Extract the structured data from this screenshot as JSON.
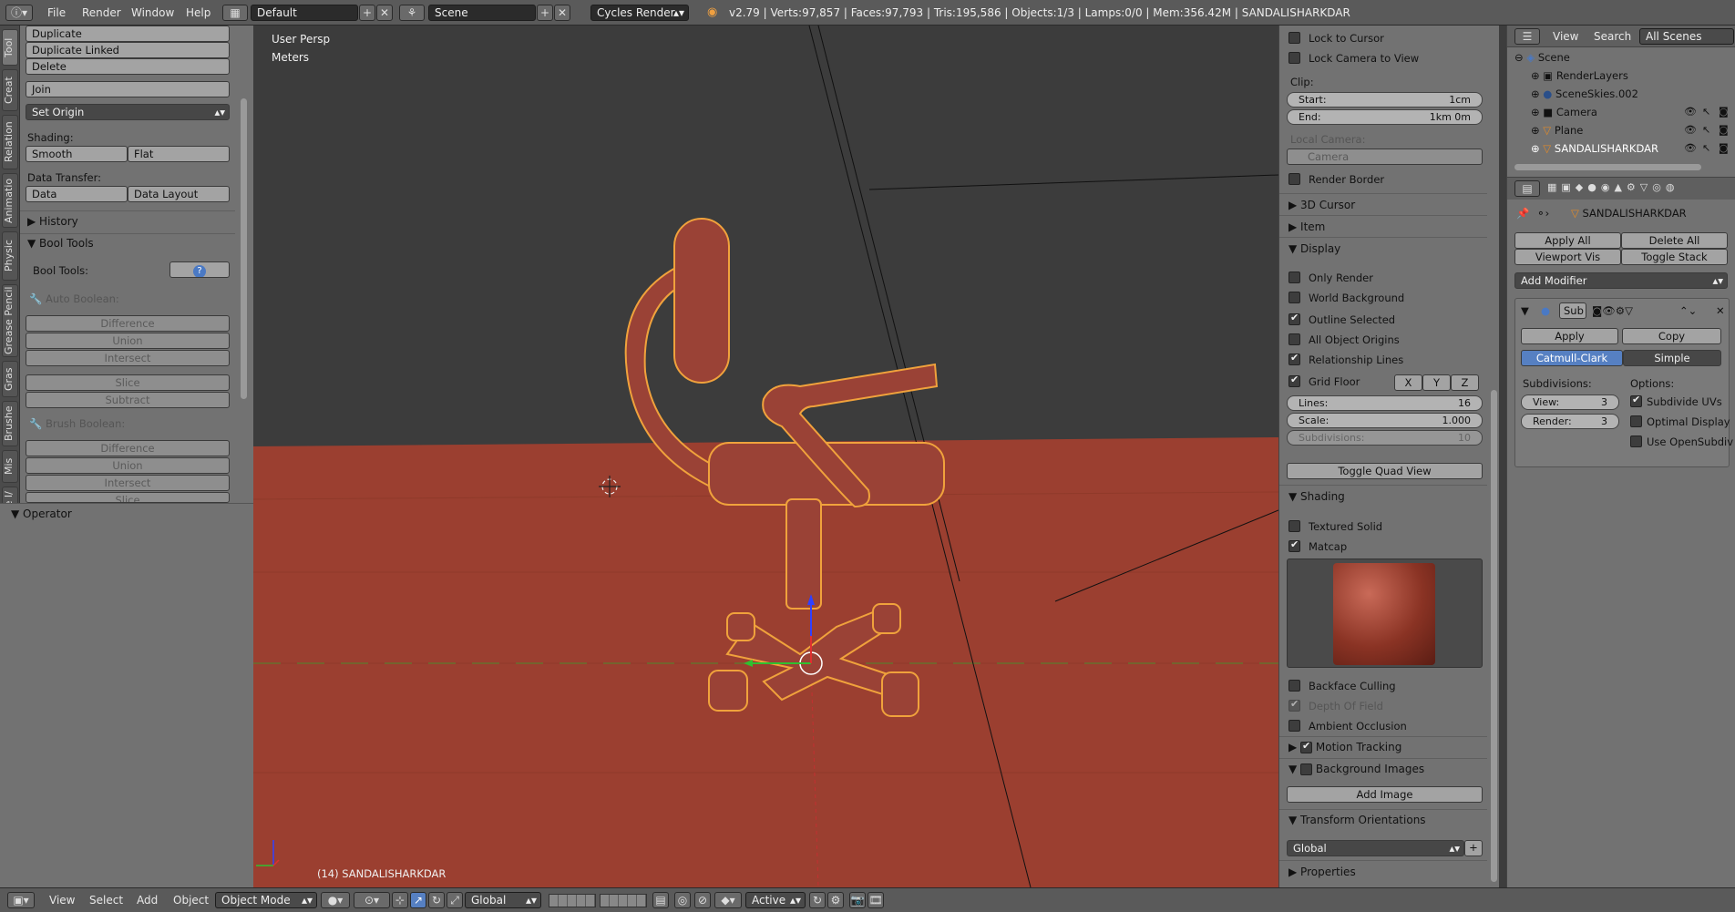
{
  "topbar": {
    "menus": [
      "File",
      "Render",
      "Window",
      "Help"
    ],
    "layout": "Default",
    "scene": "Scene",
    "engine": "Cycles Render",
    "info": "v2.79 | Verts:97,857 | Faces:97,793 | Tris:195,586 | Objects:1/3 | Lamps:0/0 | Mem:356.42M | SANDALISHARKDAR"
  },
  "vtabs": [
    "Tool",
    "Creat",
    "Relation",
    "Animatio",
    "Physic",
    "Grease Pencil",
    "Gras",
    "Brushe",
    "Mis",
    "File I/"
  ],
  "tools": {
    "duplicate": "Duplicate",
    "duplicate_linked": "Duplicate Linked",
    "delete": "Delete",
    "join": "Join",
    "set_origin": "Set Origin",
    "shading_label": "Shading:",
    "smooth": "Smooth",
    "flat": "Flat",
    "data_transfer_label": "Data Transfer:",
    "data": "Data",
    "data_layout": "Data Layout",
    "history": "History",
    "bool_tools": "Bool Tools",
    "bool_tools_label": "Bool Tools:",
    "auto_boolean": "Auto Boolean:",
    "brush_boolean": "Brush Boolean:",
    "ops": [
      "Difference",
      "Union",
      "Intersect",
      "Slice",
      "Subtract"
    ],
    "ops2": [
      "Difference",
      "Union",
      "Intersect",
      "Slice"
    ]
  },
  "operator": "Operator",
  "viewport": {
    "persp": "User Persp",
    "units": "Meters",
    "object_label": "(14) SANDALISHARKDAR",
    "colors": {
      "floor": "#9b3f30",
      "sky": "#3c3c3c",
      "chair": "#9a4236",
      "outline": "#f0a23c"
    }
  },
  "bottombar": {
    "menus": [
      "View",
      "Select",
      "Add",
      "Object"
    ],
    "mode": "Object Mode",
    "orientation": "Global",
    "pivot": "Active"
  },
  "npanel": {
    "lock_cursor": "Lock to Cursor",
    "lock_camera": "Lock Camera to View",
    "clip": "Clip:",
    "start_label": "Start:",
    "start_val": "1cm",
    "end_label": "End:",
    "end_val": "1km 0m",
    "local_camera": "Local Camera:",
    "camera": "Camera",
    "render_border": "Render Border",
    "cursor3d": "3D Cursor",
    "item": "Item",
    "display": "Display",
    "only_render": "Only Render",
    "world_bg": "World Background",
    "outline_sel": "Outline Selected",
    "all_origins": "All Object Origins",
    "rel_lines": "Relationship Lines",
    "grid_floor": "Grid Floor",
    "x": "X",
    "y": "Y",
    "z": "Z",
    "lines_label": "Lines:",
    "lines_val": "16",
    "scale_label": "Scale:",
    "scale_val": "1.000",
    "subdiv_label": "Subdivisions:",
    "subdiv_val": "10",
    "toggle_quad": "Toggle Quad View",
    "shading": "Shading",
    "textured_solid": "Textured Solid",
    "matcap": "Matcap",
    "backface": "Backface Culling",
    "dof": "Depth Of Field",
    "ao": "Ambient Occlusion",
    "motion_tracking": "Motion Tracking",
    "bg_images": "Background Images",
    "add_image": "Add Image",
    "transform_orient": "Transform Orientations",
    "global": "Global",
    "properties": "Properties"
  },
  "outliner": {
    "view": "View",
    "search": "Search",
    "all_scenes": "All Scenes",
    "items": [
      "Scene",
      "RenderLayers",
      "SceneSkies.002",
      "Camera",
      "Plane",
      "SANDALISHARKDAR"
    ]
  },
  "properties": {
    "object_name": "SANDALISHARKDAR",
    "apply_all": "Apply All",
    "delete_all": "Delete All",
    "viewport_vis": "Viewport Vis",
    "toggle_stack": "Toggle Stack",
    "add_modifier": "Add Modifier",
    "mod_name": "Sub",
    "apply": "Apply",
    "copy": "Copy",
    "catmull": "Catmull-Clark",
    "simple": "Simple",
    "subdivisions": "Subdivisions:",
    "view_label": "View:",
    "view_val": "3",
    "render_label": "Render:",
    "render_val": "3",
    "options": "Options:",
    "subdivide_uvs": "Subdivide UVs",
    "optimal_display": "Optimal Display",
    "use_opensubdiv": "Use OpenSubdiv"
  }
}
